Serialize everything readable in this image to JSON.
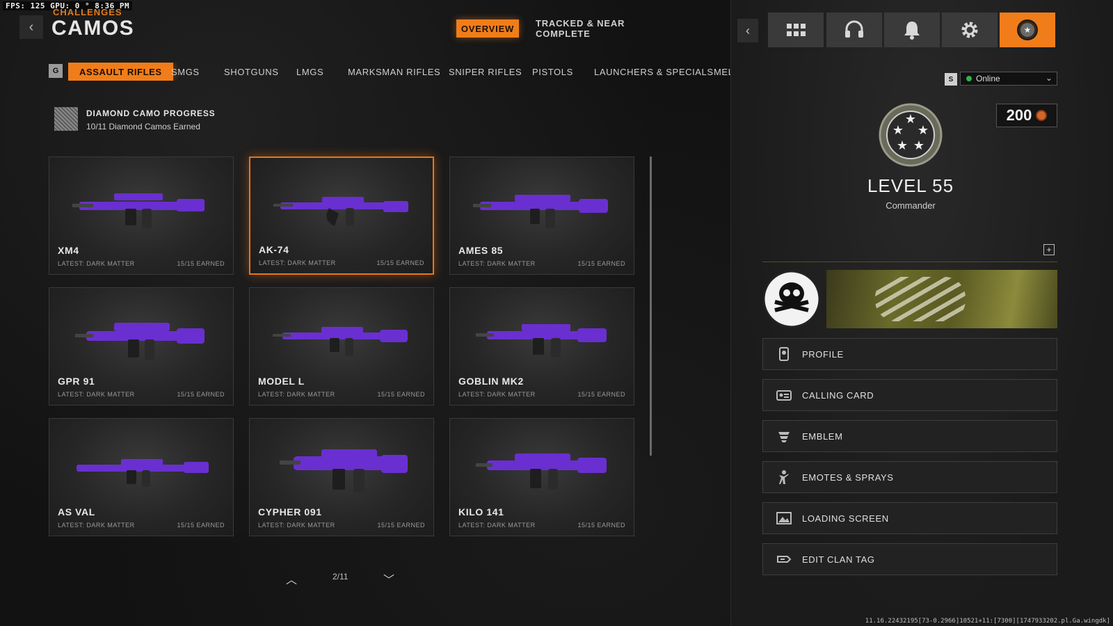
{
  "overlay": {
    "fps": "FPS: 125  GPU: 0 °  8:36 PM"
  },
  "header": {
    "subtitle": "CHALLENGES",
    "title": "CAMOS",
    "tabs": [
      {
        "label": "OVERVIEW",
        "active": true
      },
      {
        "label": "TRACKED & NEAR COMPLETE",
        "active": false
      }
    ]
  },
  "categories": {
    "key_hint": "G",
    "items": [
      {
        "label": "ASSAULT RIFLES",
        "active": true
      },
      {
        "label": "SMGS"
      },
      {
        "label": "SHOTGUNS"
      },
      {
        "label": "LMGS"
      },
      {
        "label": "MARKSMAN RIFLES"
      },
      {
        "label": "SNIPER RIFLES"
      },
      {
        "label": "PISTOLS"
      },
      {
        "label": "LAUNCHERS & SPECIALS"
      },
      {
        "label": "MELE"
      }
    ]
  },
  "diamond": {
    "title": "DIAMOND CAMO PROGRESS",
    "subtitle": "10/11 Diamond Camos Earned"
  },
  "weapons": [
    {
      "name": "XM4",
      "latest": "LATEST: DARK MATTER",
      "earned": "15/15 EARNED",
      "selected": false
    },
    {
      "name": "AK-74",
      "latest": "LATEST: DARK MATTER",
      "earned": "15/15 EARNED",
      "selected": true
    },
    {
      "name": "AMES 85",
      "latest": "LATEST: DARK MATTER",
      "earned": "15/15 EARNED",
      "selected": false
    },
    {
      "name": "GPR 91",
      "latest": "LATEST: DARK MATTER",
      "earned": "15/15 EARNED",
      "selected": false
    },
    {
      "name": "MODEL L",
      "latest": "LATEST: DARK MATTER",
      "earned": "15/15 EARNED",
      "selected": false
    },
    {
      "name": "GOBLIN MK2",
      "latest": "LATEST: DARK MATTER",
      "earned": "15/15 EARNED",
      "selected": false
    },
    {
      "name": "AS VAL",
      "latest": "LATEST: DARK MATTER",
      "earned": "15/15 EARNED",
      "selected": false
    },
    {
      "name": "CYPHER 091",
      "latest": "LATEST: DARK MATTER",
      "earned": "15/15 EARNED",
      "selected": false
    },
    {
      "name": "KILO 141",
      "latest": "LATEST: DARK MATTER",
      "earned": "15/15 EARNED",
      "selected": false
    }
  ],
  "pager": {
    "label": "2/11"
  },
  "right_panel": {
    "back_icon": "chevron-left-icon",
    "icons": [
      "grid-icon",
      "headset-icon",
      "bell-icon",
      "gear-icon",
      "rank-icon"
    ],
    "status": {
      "key_hint": "S",
      "value": "Online"
    },
    "currency": {
      "value": "200"
    },
    "level": "LEVEL 55",
    "rank": "Commander",
    "menu": [
      {
        "label": "PROFILE",
        "icon": "profile-icon"
      },
      {
        "label": "CALLING CARD",
        "icon": "calling-card-icon"
      },
      {
        "label": "EMBLEM",
        "icon": "emblem-icon"
      },
      {
        "label": "EMOTES & SPRAYS",
        "icon": "emotes-icon"
      },
      {
        "label": "LOADING SCREEN",
        "icon": "loading-screen-icon"
      },
      {
        "label": "EDIT CLAN TAG",
        "icon": "clan-tag-icon"
      }
    ]
  },
  "debug": "11.16.22432195[73-0.2966]10521+11:[7300][1747933202.pl.Ga.wingdk]",
  "colors": {
    "accent": "#f07d1a",
    "camo": "#6a2fd0",
    "online": "#2fb24a"
  }
}
